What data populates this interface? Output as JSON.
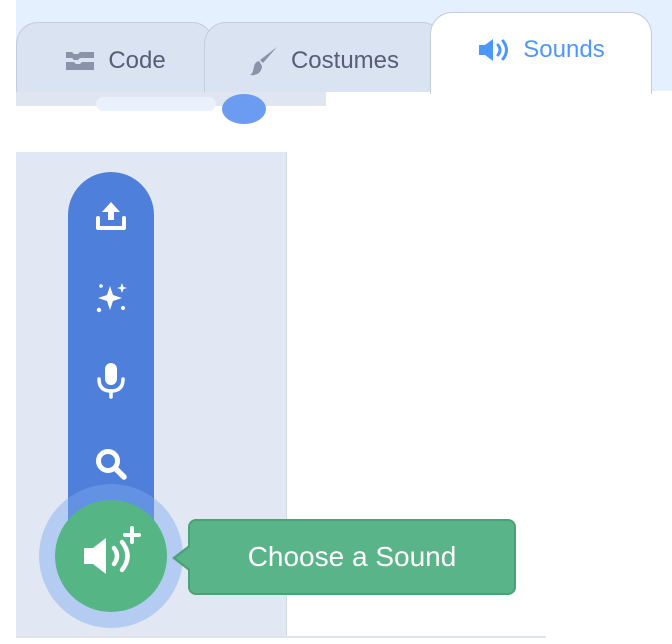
{
  "tabs": [
    {
      "label": "Code",
      "icon": "code-blocks-icon",
      "active": false
    },
    {
      "label": "Costumes",
      "icon": "paintbrush-icon",
      "active": false
    },
    {
      "label": "Sounds",
      "icon": "speaker-icon",
      "active": true
    }
  ],
  "sound_menu": {
    "items": [
      {
        "icon": "upload-icon"
      },
      {
        "icon": "surprise-sparkles-icon"
      },
      {
        "icon": "microphone-icon"
      },
      {
        "icon": "search-icon"
      }
    ],
    "main_button_icon": "add-sound-icon",
    "tooltip": "Choose a Sound"
  },
  "colors": {
    "active_tab_text": "#4c97ff",
    "inactive_tab_text": "#575e75",
    "menu_blue": "#4d7fdb",
    "choose_green": "#55b585",
    "tooltip_green": "#59b589"
  }
}
